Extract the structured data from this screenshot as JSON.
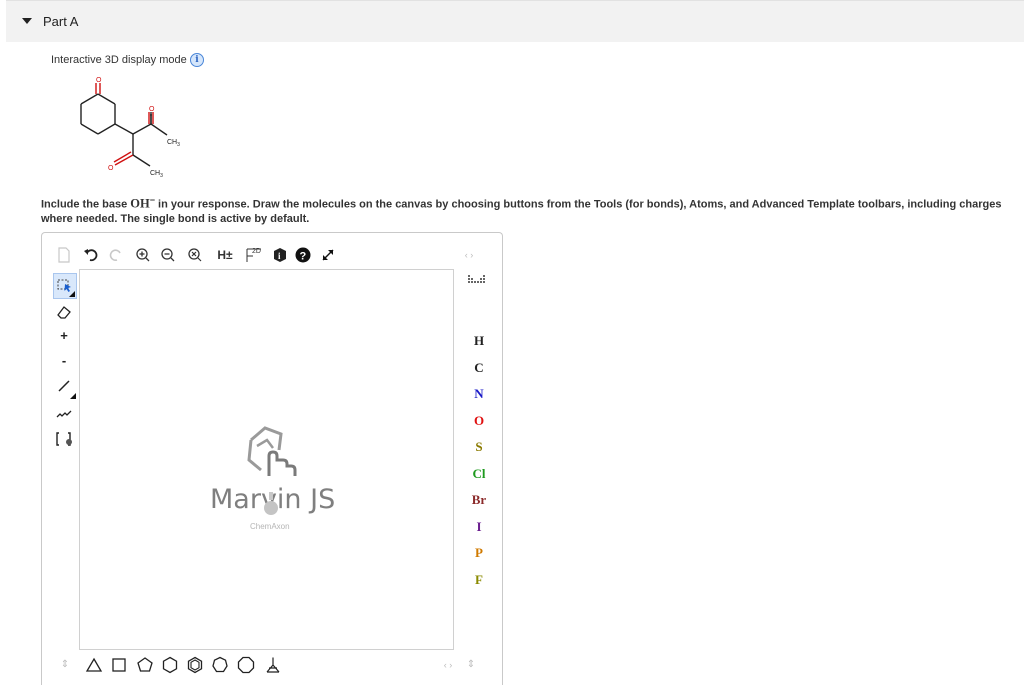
{
  "part": {
    "title": "Part A"
  },
  "mode": {
    "label": "Interactive 3D display mode"
  },
  "molecule": {
    "methyl_label_1": "CH",
    "methyl_label_2": "CH",
    "subscript": "3"
  },
  "instructions": {
    "before": "Include the base ",
    "chem": "OH",
    "charge": "−",
    "after": " in your response. Draw the molecules on the canvas by choosing buttons from the Tools (for bonds), Atoms, and Advanced Template toolbars, including charges where needed. The single bond is active by default."
  },
  "editor": {
    "logo_text": "Marvin JS",
    "logo_sub": "ChemAxon",
    "h_toggle": "H±",
    "ruler_label": "2D",
    "help": "?",
    "plus": "+",
    "minus": "-",
    "atoms": [
      {
        "symbol": "H",
        "color": "#222222"
      },
      {
        "symbol": "C",
        "color": "#222222"
      },
      {
        "symbol": "N",
        "color": "#1a1ac8"
      },
      {
        "symbol": "O",
        "color": "#e01010"
      },
      {
        "symbol": "S",
        "color": "#8a7a00"
      },
      {
        "symbol": "Cl",
        "color": "#1e9a1e"
      },
      {
        "symbol": "Br",
        "color": "#8b2a2a"
      },
      {
        "symbol": "I",
        "color": "#6b1f8f"
      },
      {
        "symbol": "P",
        "color": "#d07a00"
      },
      {
        "symbol": "F",
        "color": "#8a8a00"
      }
    ],
    "templates": [
      "triangle",
      "square",
      "pentagon",
      "hexagon",
      "hexagon-benzene",
      "heptagon",
      "octagon",
      "chair"
    ]
  }
}
